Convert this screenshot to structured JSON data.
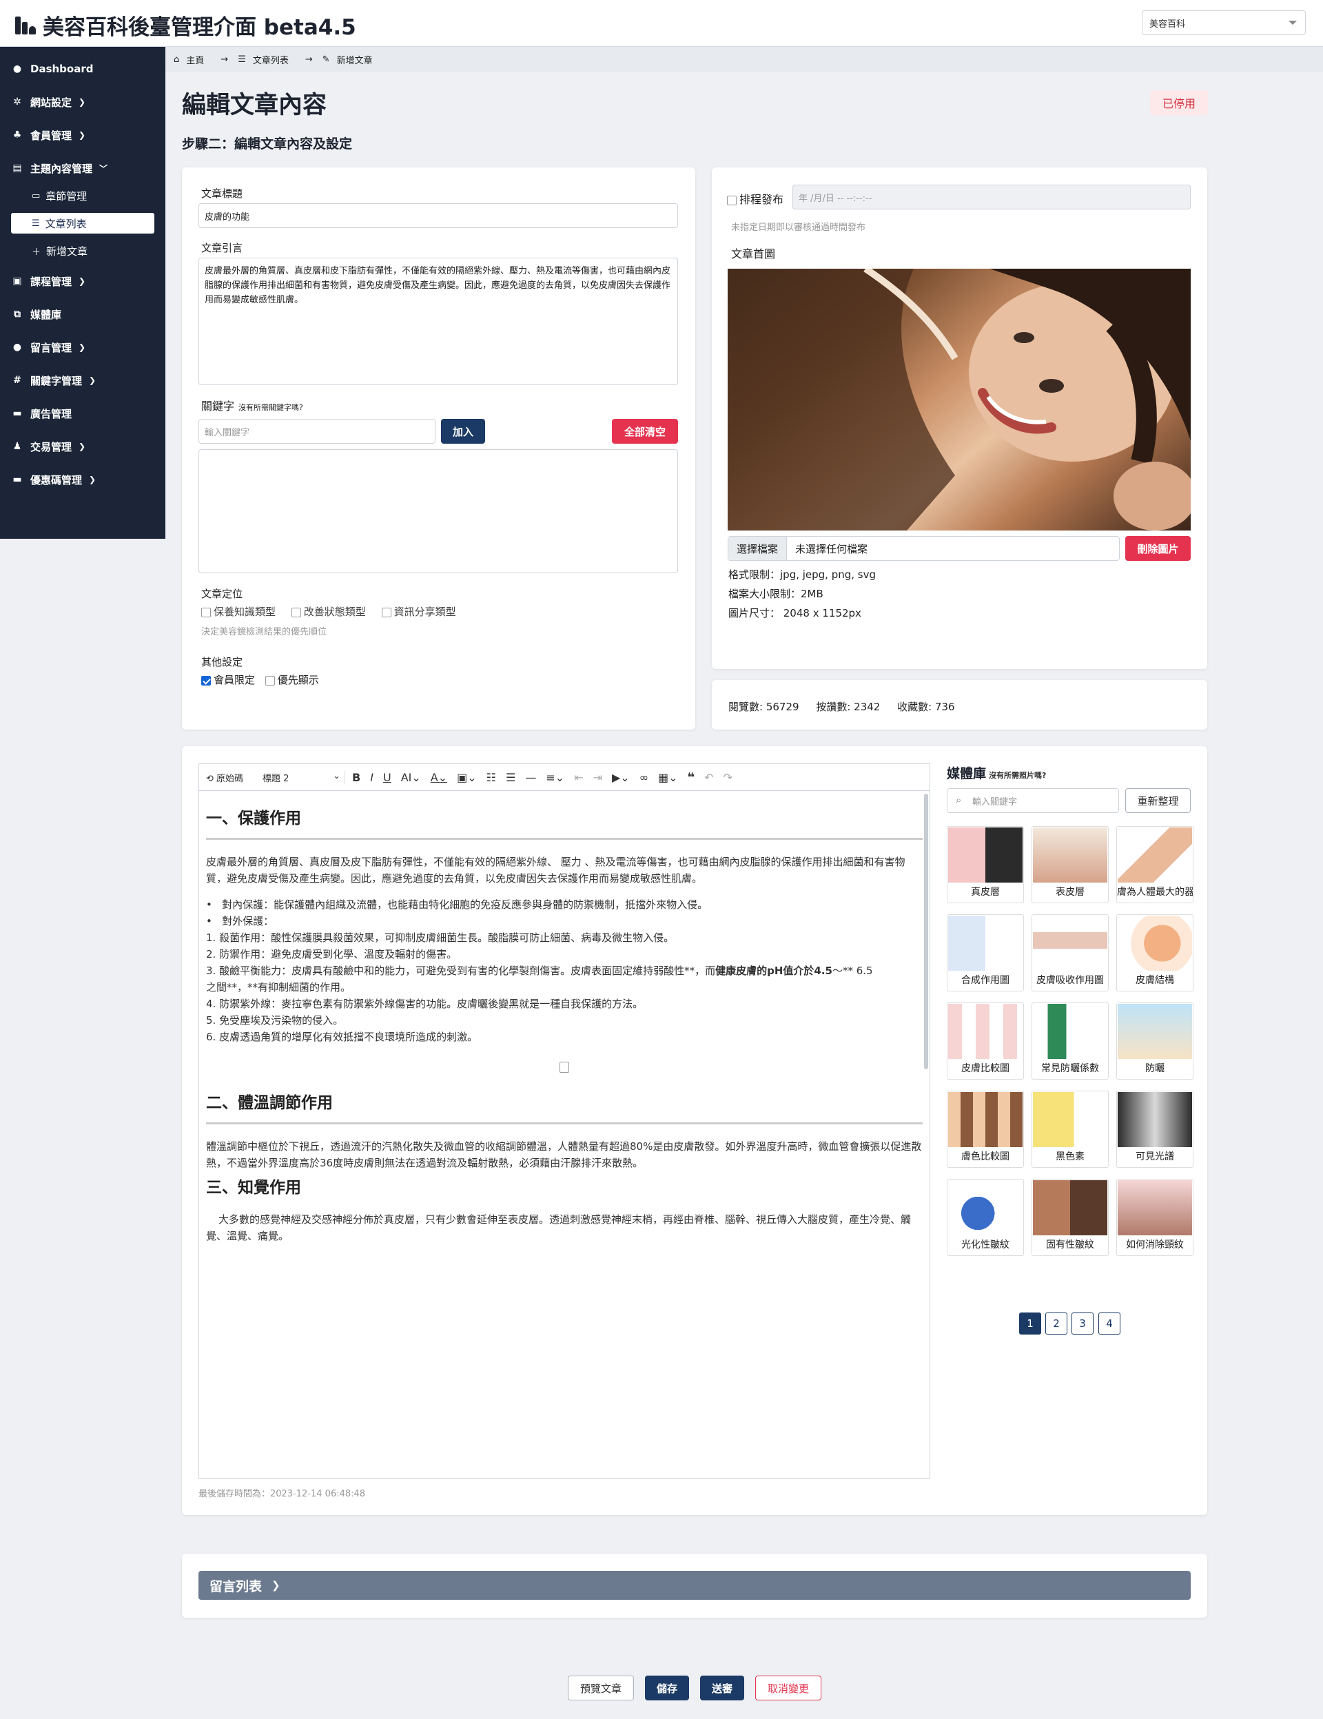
{
  "app": {
    "title": "美容百科後臺管理介面 beta4.5",
    "site_select": "美容百科"
  },
  "sidebar": {
    "items": [
      {
        "label": "Dashboard"
      },
      {
        "label": "網站設定"
      },
      {
        "label": "會員管理"
      },
      {
        "label": "主題內容管理"
      },
      {
        "label": "章節管理"
      },
      {
        "label": "文章列表"
      },
      {
        "label": "新增文章"
      },
      {
        "label": "課程管理"
      },
      {
        "label": "媒體庫"
      },
      {
        "label": "留言管理"
      },
      {
        "label": "關鍵字管理"
      },
      {
        "label": "廣告管理"
      },
      {
        "label": "交易管理"
      },
      {
        "label": "優惠碼管理"
      }
    ]
  },
  "breadcrumb": {
    "home": "主頁",
    "list": "文章列表",
    "current": "新增文章"
  },
  "page": {
    "title": "編輯文章內容",
    "step": "步驟二：編輯文章內容及設定",
    "status_badge": "已停用"
  },
  "form": {
    "title_label": "文章標題",
    "title_value": "皮膚的功能",
    "intro_label": "文章引言",
    "intro_value": "皮膚最外層的角質層、真皮層和皮下脂肪有彈性，不僅能有效的隔絕紫外線、壓力、熱及電流等傷害，也可藉由網內皮脂腺的保護作用排出細菌和有害物質，避免皮膚受傷及產生病變。因此，應避免過度的去角質，以免皮膚因失去保護作用而易變成敏感性肌膚。",
    "keyword_label": "關鍵字",
    "keyword_hint": "沒有所需關鍵字嗎?",
    "keyword_placeholder": "輸入關鍵字",
    "add_btn": "加入",
    "clear_btn": "全部清空",
    "position_label": "文章定位",
    "position_options": [
      "保養知識類型",
      "改善狀態類型",
      "資訊分享類型"
    ],
    "position_hint": "決定美容鏡檢測結果的優先順位",
    "other_label": "其他設定",
    "member_only": "會員限定",
    "priority": "優先顯示"
  },
  "schedule": {
    "label": "排程發布",
    "date_placeholder": "年 /月/日 -- --:--:--",
    "hint": "未指定日期即以審核通過時間發布",
    "cover_label": "文章首圖",
    "choose_file": "選擇檔案",
    "no_file": "未選擇任何檔案",
    "delete_img": "刪除圖片",
    "format": "格式限制：jpg, jepg, png, svg",
    "size_limit": "檔案大小限制：2MB",
    "dimension": "圖片尺寸： 2048 x 1152px"
  },
  "stats": {
    "views": "閱覽數: 56729",
    "likes": "按讚數: 2342",
    "favorites": "收藏數: 736"
  },
  "editor": {
    "toolbar": {
      "source": "原始碼",
      "heading": "標題 2"
    },
    "h1": "一、保護作用",
    "p1": "皮膚最外層的角質層、真皮層及皮下脂肪有彈性，不僅能有效的隔絕紫外線、 壓力 、熱及電流等傷害，也可藉由網內皮脂腺的保護作用排出細菌和有害物質，避免皮膚受傷及產生病變。因此，應避免過度的去角質，以免皮膚因失去保護作用而易變成敏感性肌膚。",
    "b1": "對內保護：能保護體內組織及流體，也能藉由特化細胞的免疫反應參與身體的防禦機制，抵擋外來物入侵。",
    "b2": "對外保護：",
    "l1": "1. 殺菌作用：酸性保護膜具殺菌效果，可抑制皮膚細菌生長。酸脂膜可防止細菌、病毒及微生物入侵。",
    "l2": "2. 防禦作用：避免皮膚受到化學、溫度及輻射的傷害。",
    "l3a": "3. 酸鹼平衡能力：皮膚具有酸鹼中和的能力，可避免受到有害的化學製劑傷害。皮膚表面固定維持弱酸性**，而",
    "l3b": "健康皮膚的pH值介於4.5",
    "l3c": "～** 6.5",
    "l3d": "之間**，**有抑制細菌的作用。",
    "l4": "4. 防禦紫外線：麥拉寧色素有防禦紫外線傷害的功能。皮膚曬後變黑就是一種自我保護的方法。",
    "l5": "5. 免受塵埃及污染物的侵入。",
    "l6": "6. 皮膚透過角質的增厚化有效抵擋不良環境所造成的刺激。",
    "h2": "二、體溫調節作用",
    "p2": "體溫調節中樞位於下視丘，透過流汗的汽熱化散失及微血管的收縮調節體溫，人體熱量有超過80%是由皮膚散發。如外界溫度升高時，微血管會擴張以促進散熱，不過當外界溫度高於36度時皮膚則無法在透過對流及輻射散熱，必須藉由汗腺排汗來散熱。",
    "h3": "三、知覺作用",
    "p3": "大多數的感覺神經及交感神經分佈於真皮層，只有少數會延伸至表皮層。透過刺激感覺神經末梢，再經由脊椎、腦幹、視丘傳入大腦皮質，產生冷覺、觸覺、溫覺、痛覺。",
    "last_saved": "最後儲存時間為：2023-12-14 06:48:48"
  },
  "media": {
    "title": "媒體庫",
    "hint": "沒有所需照片嗎?",
    "search_placeholder": "輸入關鍵字",
    "refresh_btn": "重新整理",
    "items": [
      "真皮層",
      "表皮層",
      "膚為人體最大的器",
      "合成作用圖",
      "皮膚吸收作用圖",
      "皮膚結構",
      "皮膚比較圖",
      "常見防曬係數",
      "防曬",
      "膚色比較圖",
      "黑色素",
      "可見光譜",
      "光化性皺紋",
      "固有性皺紋",
      "如何消除頸紋"
    ],
    "pages": [
      "1",
      "2",
      "3",
      "4"
    ]
  },
  "comments": {
    "title": "留言列表"
  },
  "actions": {
    "preview": "預覽文章",
    "save": "儲存",
    "submit": "送審",
    "cancel": "取消變更"
  }
}
